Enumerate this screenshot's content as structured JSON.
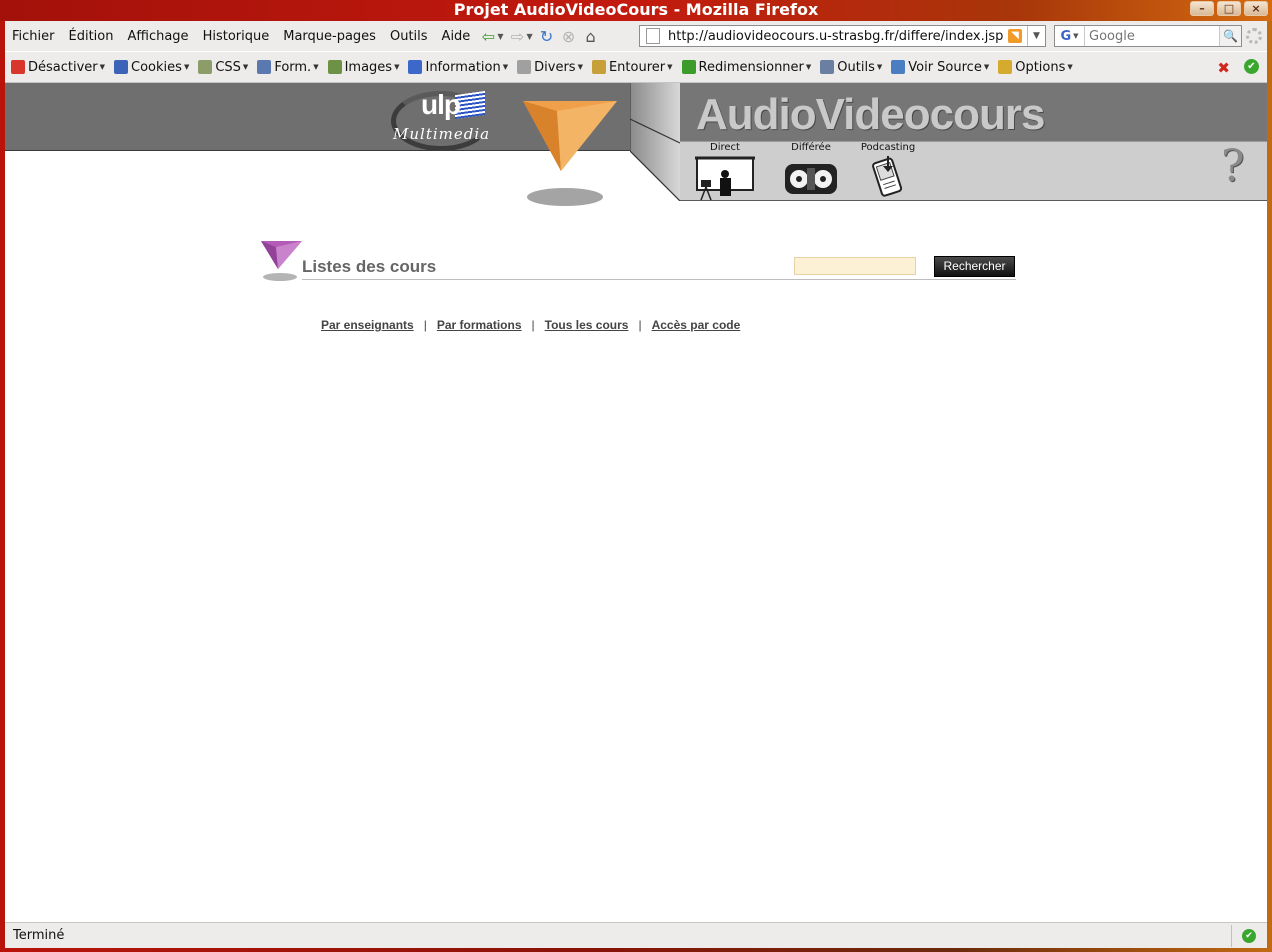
{
  "window": {
    "title": "Projet AudioVideoCours - Mozilla Firefox",
    "buttons": [
      "–",
      "□",
      "×"
    ]
  },
  "menubar": {
    "items": [
      "Fichier",
      "Édition",
      "Affichage",
      "Historique",
      "Marque-pages",
      "Outils",
      "Aide"
    ]
  },
  "urlbar": {
    "url": "http://audiovideocours.u-strasbg.fr/differe/index.jsp"
  },
  "searchbar": {
    "placeholder": "Google",
    "engine_letter": "G"
  },
  "devbar": {
    "items": [
      {
        "label": "Désactiver",
        "icon": "disable-icon",
        "color": "#d9362b"
      },
      {
        "label": "Cookies",
        "icon": "cookie-person-icon",
        "color": "#3d63b8"
      },
      {
        "label": "CSS",
        "icon": "css-icon",
        "color": "#8c9d6a"
      },
      {
        "label": "Form.",
        "icon": "form-icon",
        "color": "#5a79b0"
      },
      {
        "label": "Images",
        "icon": "image-icon",
        "color": "#6d9246"
      },
      {
        "label": "Information",
        "icon": "info-icon",
        "color": "#3c68c9"
      },
      {
        "label": "Divers",
        "icon": "misc-icon",
        "color": "#a0a0a0"
      },
      {
        "label": "Entourer",
        "icon": "outline-pen-icon",
        "color": "#c7a03a"
      },
      {
        "label": "Redimensionner",
        "icon": "resize-icon",
        "color": "#3d9b2c"
      },
      {
        "label": "Outils",
        "icon": "wrench-icon",
        "color": "#6b7fa3"
      },
      {
        "label": "Voir Source",
        "icon": "view-source-icon",
        "color": "#4a7dc2"
      },
      {
        "label": "Options",
        "icon": "key-icon",
        "color": "#d4aa2f"
      }
    ]
  },
  "banner": {
    "logo_text": "ulp",
    "logo_sub": "Multimedia",
    "site_title": "AudioVideocours",
    "nav": [
      {
        "label": "Direct",
        "icon": "direct-camera-icon"
      },
      {
        "label": "Différée",
        "icon": "differee-tape-icon"
      },
      {
        "label": "Podcasting",
        "icon": "podcasting-device-icon"
      }
    ],
    "help": "?"
  },
  "courses": {
    "title": "Listes des cours",
    "search_value": "",
    "search_button": "Rechercher",
    "links": [
      "Par enseignants",
      "Par formations",
      "Tous les cours",
      "Accès par code"
    ],
    "separator": "|"
  },
  "statusbar": {
    "text": "Terminé"
  },
  "colors": {
    "banner_dark": "#6f6f6f",
    "banner_light": "#cecece",
    "accent_orange": "#f0a04b",
    "accent_purple": "#b45bb8",
    "search_field_bg": "#fdf1d5"
  }
}
